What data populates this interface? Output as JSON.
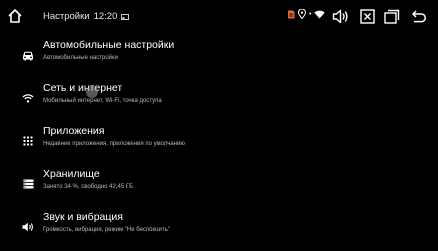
{
  "status_bar": {
    "title": "Настройки",
    "time": "12:20",
    "home_icon": "home-icon",
    "cast_icon": "cast-icon",
    "system_icons": [
      "sim-card-icon",
      "location-icon",
      "wifi-icon"
    ],
    "nav_icons": [
      "volume-icon",
      "close-box-icon",
      "recent-apps-icon",
      "back-icon"
    ]
  },
  "settings": {
    "items": [
      {
        "label": "Автомобильные настройки",
        "sub": "Автомобильные настройки",
        "icon": "car-icon"
      },
      {
        "label": "Сеть и интернет",
        "sub": "Мобильный интернет, Wi-Fi, точка доступа",
        "icon": "wifi-icon"
      },
      {
        "label": "Приложения",
        "sub": "Недавние приложения, приложения по умолчанию",
        "icon": "apps-grid-icon"
      },
      {
        "label": "Хранилище",
        "sub": "Занято 34 %, свободно 42,45 ГБ",
        "icon": "storage-icon"
      },
      {
        "label": "Звук и вибрация",
        "sub": "Громкость, вибрация, режим \"Не беспокоить\"",
        "icon": "sound-icon"
      }
    ]
  },
  "colors": {
    "background": "#000000",
    "text": "#ffffff",
    "subtext": "#b8b8b8",
    "sim_accent": "#e06a3a"
  }
}
